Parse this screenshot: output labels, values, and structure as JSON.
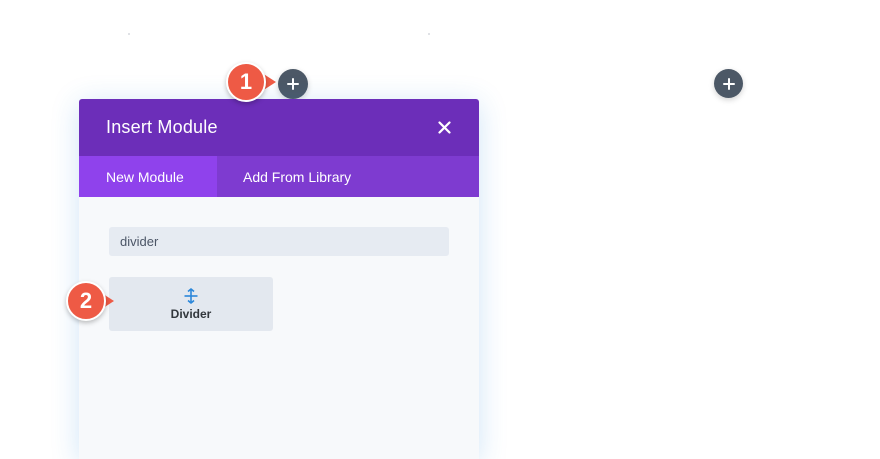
{
  "canvas": {
    "add_row_button_icon": "plus-icon",
    "add_column_button_icon": "plus-icon"
  },
  "modal": {
    "title": "Insert Module",
    "close_icon": "close-icon",
    "tabs": [
      {
        "label": "New Module",
        "active": true
      },
      {
        "label": "Add From Library",
        "active": false
      }
    ],
    "search": {
      "value": "divider",
      "placeholder": ""
    },
    "modules": [
      {
        "label": "Divider",
        "icon": "divider-icon"
      }
    ]
  },
  "annotations": [
    {
      "label": "1"
    },
    {
      "label": "2"
    }
  ],
  "colors": {
    "header": "#6c2eb9",
    "tabs_bar": "#7e3bd0",
    "active_tab": "#8f42ec",
    "callout": "#ee5a45",
    "add_button": "#4c5866",
    "icon_blue": "#2b87da"
  }
}
